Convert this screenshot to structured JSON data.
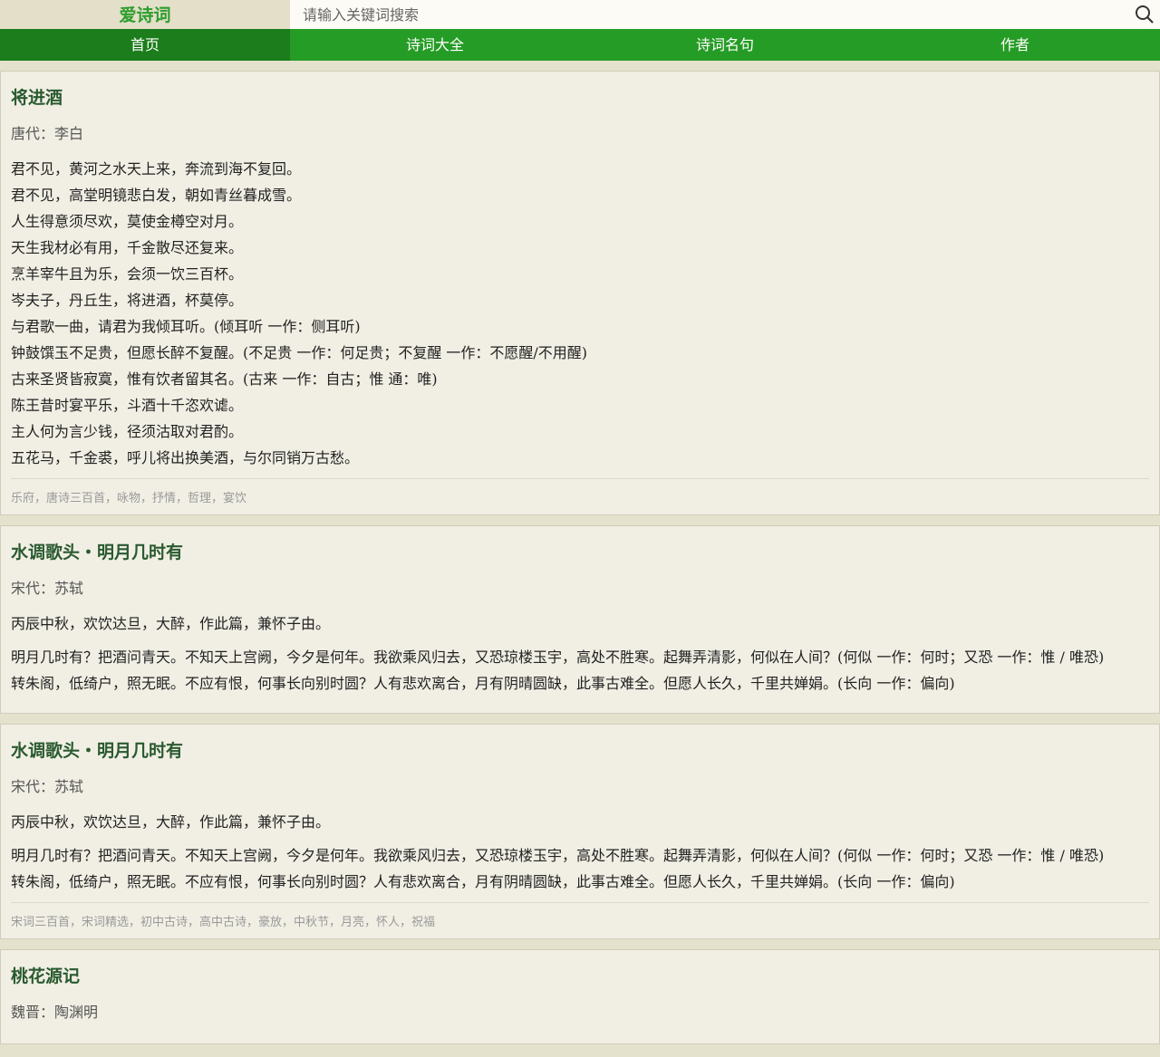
{
  "header": {
    "logo": "爱诗词",
    "search_placeholder": "请输入关键词搜索"
  },
  "nav": [
    "首页",
    "诗词大全",
    "诗词名句",
    "作者"
  ],
  "poems": [
    {
      "title": "将进酒",
      "author": "唐代：李白",
      "paras": [
        [
          "君不见，黄河之水天上来，奔流到海不复回。",
          "君不见，高堂明镜悲白发，朝如青丝暮成雪。",
          "人生得意须尽欢，莫使金樽空对月。",
          "天生我材必有用，千金散尽还复来。",
          "烹羊宰牛且为乐，会须一饮三百杯。",
          "岑夫子，丹丘生，将进酒，杯莫停。",
          "与君歌一曲，请君为我倾耳听。(倾耳听 一作：侧耳听)",
          "钟鼓馔玉不足贵，但愿长醉不复醒。(不足贵 一作：何足贵；不复醒 一作：不愿醒/不用醒)",
          "古来圣贤皆寂寞，惟有饮者留其名。(古来 一作：自古；惟 通：唯)",
          "陈王昔时宴平乐，斗酒十千恣欢谑。",
          "主人何为言少钱，径须沽取对君酌。",
          "五花马，千金裘，呼儿将出换美酒，与尔同销万古愁。"
        ]
      ],
      "tags": "乐府，唐诗三百首，咏物，抒情，哲理，宴饮"
    },
    {
      "title": "水调歌头・明月几时有",
      "author": "宋代：苏轼",
      "paras": [
        [
          "丙辰中秋，欢饮达旦，大醉，作此篇，兼怀子由。"
        ],
        [
          "明月几时有？把酒问青天。不知天上宫阙，今夕是何年。我欲乘风归去，又恐琼楼玉宇，高处不胜寒。起舞弄清影，何似在人间？(何似 一作：何时；又恐 一作：惟 / 唯恐)",
          "转朱阁，低绮户，照无眠。不应有恨，何事长向别时圆？人有悲欢离合，月有阴晴圆缺，此事古难全。但愿人长久，千里共婵娟。(长向 一作：偏向)"
        ]
      ],
      "tags": ""
    },
    {
      "title": "水调歌头・明月几时有",
      "author": "宋代：苏轼",
      "paras": [
        [
          "丙辰中秋，欢饮达旦，大醉，作此篇，兼怀子由。"
        ],
        [
          "明月几时有？把酒问青天。不知天上宫阙，今夕是何年。我欲乘风归去，又恐琼楼玉宇，高处不胜寒。起舞弄清影，何似在人间？(何似 一作：何时；又恐 一作：惟 / 唯恐)",
          "转朱阁，低绮户，照无眠。不应有恨，何事长向别时圆？人有悲欢离合，月有阴晴圆缺，此事古难全。但愿人长久，千里共婵娟。(长向 一作：偏向)"
        ]
      ],
      "tags": "宋词三百首，宋词精选，初中古诗，高中古诗，豪放，中秋节，月亮，怀人，祝福"
    },
    {
      "title": "桃花源记",
      "author": "魏晋：陶渊明",
      "paras": [],
      "tags": ""
    }
  ]
}
